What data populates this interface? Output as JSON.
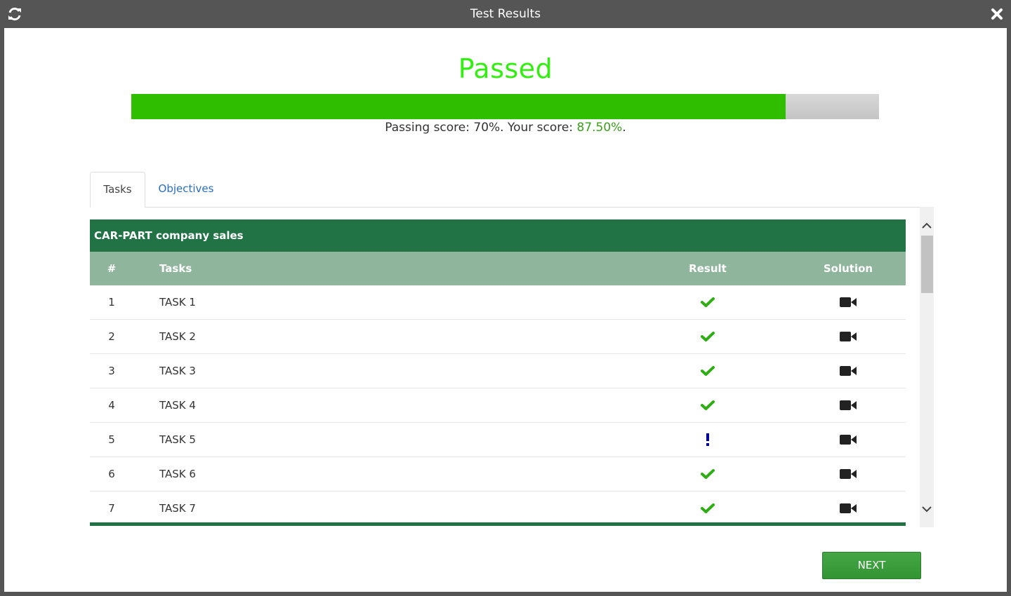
{
  "window": {
    "title": "Test Results",
    "refresh_icon": "refresh-icon",
    "close_icon": "close-icon"
  },
  "result": {
    "status": "Passed",
    "status_color": "#33ee11",
    "passing_label": "Passing score: 70%. Your score: ",
    "passing_score_percent": 70,
    "your_score": "87.50%",
    "your_score_percent": 87.5,
    "score_suffix": ".",
    "progress_fraction": 0.875,
    "progress_color": "#2fbe00"
  },
  "tabs": [
    {
      "label": "Tasks",
      "active": true
    },
    {
      "label": "Objectives",
      "active": false
    }
  ],
  "table": {
    "title": "CAR-PART company sales",
    "headers": {
      "num": "#",
      "task": "Tasks",
      "result": "Result",
      "solution": "Solution"
    },
    "rows": [
      {
        "num": "1",
        "task": "TASK 1",
        "result": "check-icon",
        "solution": "video-camera-icon"
      },
      {
        "num": "2",
        "task": "TASK 2",
        "result": "check-icon",
        "solution": "video-camera-icon"
      },
      {
        "num": "3",
        "task": "TASK 3",
        "result": "check-icon",
        "solution": "video-camera-icon"
      },
      {
        "num": "4",
        "task": "TASK 4",
        "result": "check-icon",
        "solution": "video-camera-icon"
      },
      {
        "num": "5",
        "task": "TASK 5",
        "result": "exclamation-icon",
        "solution": "video-camera-icon"
      },
      {
        "num": "6",
        "task": "TASK 6",
        "result": "check-icon",
        "solution": "video-camera-icon"
      },
      {
        "num": "7",
        "task": "TASK 7",
        "result": "check-icon",
        "solution": "video-camera-icon"
      }
    ],
    "header_color": "#217346",
    "subheader_color": "#8fb59d"
  },
  "footer": {
    "next_label": "NEXT"
  }
}
